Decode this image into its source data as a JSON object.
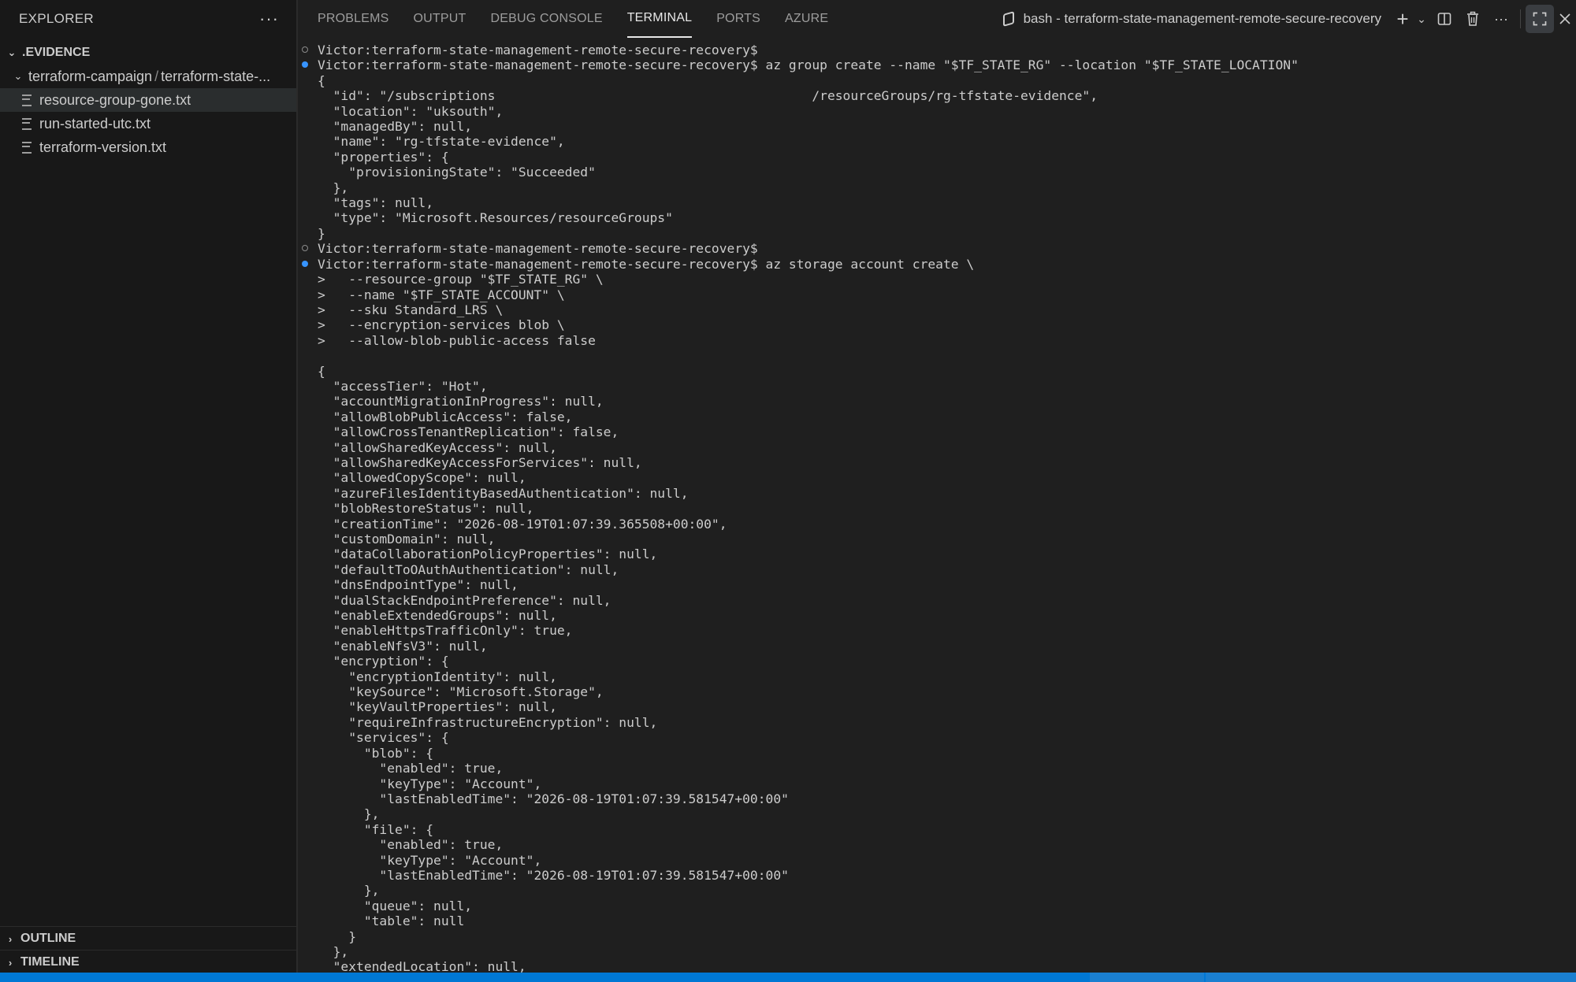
{
  "sidebar": {
    "title": "EXPLORER",
    "more": "···",
    "section": ".EVIDENCE",
    "folder": {
      "part1": "terraform-campaign",
      "sep": "/",
      "part2": "terraform-state-..."
    },
    "files": [
      "resource-group-gone.txt",
      "run-started-utc.txt",
      "terraform-version.txt"
    ],
    "outline": "OUTLINE",
    "timeline": "TIMELINE"
  },
  "panel": {
    "tabs": [
      "PROBLEMS",
      "OUTPUT",
      "DEBUG CONSOLE",
      "TERMINAL",
      "PORTS",
      "AZURE"
    ],
    "active_tab": "TERMINAL",
    "terminal_title": "bash - terraform-state-management-remote-secure-recovery",
    "icons": [
      "bash-terminal-icon",
      "plus-icon",
      "chevron-down-icon",
      "split-icon",
      "trash-icon",
      "ellipsis-icon",
      "maximize-icon",
      "close-icon"
    ]
  },
  "terminal": {
    "lines": [
      {
        "d": "hollow",
        "t": "Victor:terraform-state-management-remote-secure-recovery$"
      },
      {
        "d": "filled",
        "t": "Victor:terraform-state-management-remote-secure-recovery$ az group create --name \"$TF_STATE_RG\" --location \"$TF_STATE_LOCATION\""
      },
      {
        "d": "",
        "t": "{"
      },
      {
        "d": "",
        "t": "  \"id\": \"/subscriptions                                         /resourceGroups/rg-tfstate-evidence\","
      },
      {
        "d": "",
        "t": "  \"location\": \"uksouth\","
      },
      {
        "d": "",
        "t": "  \"managedBy\": null,"
      },
      {
        "d": "",
        "t": "  \"name\": \"rg-tfstate-evidence\","
      },
      {
        "d": "",
        "t": "  \"properties\": {"
      },
      {
        "d": "",
        "t": "    \"provisioningState\": \"Succeeded\""
      },
      {
        "d": "",
        "t": "  },"
      },
      {
        "d": "",
        "t": "  \"tags\": null,"
      },
      {
        "d": "",
        "t": "  \"type\": \"Microsoft.Resources/resourceGroups\""
      },
      {
        "d": "",
        "t": "}"
      },
      {
        "d": "hollow",
        "t": "Victor:terraform-state-management-remote-secure-recovery$"
      },
      {
        "d": "filled",
        "t": "Victor:terraform-state-management-remote-secure-recovery$ az storage account create \\"
      },
      {
        "d": "",
        "t": ">   --resource-group \"$TF_STATE_RG\" \\"
      },
      {
        "d": "",
        "t": ">   --name \"$TF_STATE_ACCOUNT\" \\"
      },
      {
        "d": "",
        "t": ">   --sku Standard_LRS \\"
      },
      {
        "d": "",
        "t": ">   --encryption-services blob \\"
      },
      {
        "d": "",
        "t": ">   --allow-blob-public-access false"
      },
      {
        "d": "",
        "t": ""
      },
      {
        "d": "",
        "t": "{"
      },
      {
        "d": "",
        "t": "  \"accessTier\": \"Hot\","
      },
      {
        "d": "",
        "t": "  \"accountMigrationInProgress\": null,"
      },
      {
        "d": "",
        "t": "  \"allowBlobPublicAccess\": false,"
      },
      {
        "d": "",
        "t": "  \"allowCrossTenantReplication\": false,"
      },
      {
        "d": "",
        "t": "  \"allowSharedKeyAccess\": null,"
      },
      {
        "d": "",
        "t": "  \"allowSharedKeyAccessForServices\": null,"
      },
      {
        "d": "",
        "t": "  \"allowedCopyScope\": null,"
      },
      {
        "d": "",
        "t": "  \"azureFilesIdentityBasedAuthentication\": null,"
      },
      {
        "d": "",
        "t": "  \"blobRestoreStatus\": null,"
      },
      {
        "d": "",
        "t": "  \"creationTime\": \"2026-08-19T01:07:39.365508+00:00\","
      },
      {
        "d": "",
        "t": "  \"customDomain\": null,"
      },
      {
        "d": "",
        "t": "  \"dataCollaborationPolicyProperties\": null,"
      },
      {
        "d": "",
        "t": "  \"defaultToOAuthAuthentication\": null,"
      },
      {
        "d": "",
        "t": "  \"dnsEndpointType\": null,"
      },
      {
        "d": "",
        "t": "  \"dualStackEndpointPreference\": null,"
      },
      {
        "d": "",
        "t": "  \"enableExtendedGroups\": null,"
      },
      {
        "d": "",
        "t": "  \"enableHttpsTrafficOnly\": true,"
      },
      {
        "d": "",
        "t": "  \"enableNfsV3\": null,"
      },
      {
        "d": "",
        "t": "  \"encryption\": {"
      },
      {
        "d": "",
        "t": "    \"encryptionIdentity\": null,"
      },
      {
        "d": "",
        "t": "    \"keySource\": \"Microsoft.Storage\","
      },
      {
        "d": "",
        "t": "    \"keyVaultProperties\": null,"
      },
      {
        "d": "",
        "t": "    \"requireInfrastructureEncryption\": null,"
      },
      {
        "d": "",
        "t": "    \"services\": {"
      },
      {
        "d": "",
        "t": "      \"blob\": {"
      },
      {
        "d": "",
        "t": "        \"enabled\": true,"
      },
      {
        "d": "",
        "t": "        \"keyType\": \"Account\","
      },
      {
        "d": "",
        "t": "        \"lastEnabledTime\": \"2026-08-19T01:07:39.581547+00:00\""
      },
      {
        "d": "",
        "t": "      },"
      },
      {
        "d": "",
        "t": "      \"file\": {"
      },
      {
        "d": "",
        "t": "        \"enabled\": true,"
      },
      {
        "d": "",
        "t": "        \"keyType\": \"Account\","
      },
      {
        "d": "",
        "t": "        \"lastEnabledTime\": \"2026-08-19T01:07:39.581547+00:00\""
      },
      {
        "d": "",
        "t": "      },"
      },
      {
        "d": "",
        "t": "      \"queue\": null,"
      },
      {
        "d": "",
        "t": "      \"table\": null"
      },
      {
        "d": "",
        "t": "    }"
      },
      {
        "d": "",
        "t": "  },"
      },
      {
        "d": "",
        "t": "  \"extendedLocation\": null,"
      }
    ]
  },
  "colors": {
    "background": "#1f1f1f",
    "sidebar": "#181818",
    "accent": "#0078d4",
    "decoration_filled": "#3794ff"
  }
}
